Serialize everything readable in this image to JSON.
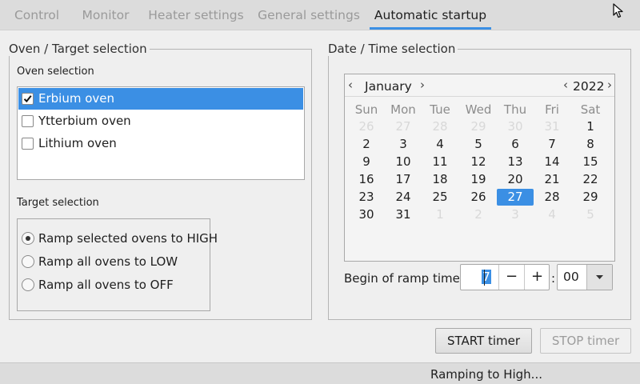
{
  "tabs": [
    {
      "label": "Control",
      "active": false
    },
    {
      "label": "Monitor",
      "active": false
    },
    {
      "label": "Heater settings",
      "active": false
    },
    {
      "label": "General settings",
      "active": false
    },
    {
      "label": "Automatic startup",
      "active": true
    }
  ],
  "oven_group": {
    "title": "Oven / Target selection",
    "oven_selection_label": "Oven selection",
    "ovens": [
      {
        "label": "Erbium oven",
        "checked": true,
        "selected": true
      },
      {
        "label": "Ytterbium oven",
        "checked": false,
        "selected": false
      },
      {
        "label": "Lithium oven",
        "checked": false,
        "selected": false
      }
    ],
    "target_selection_label": "Target selection",
    "targets": [
      {
        "label": "Ramp selected ovens to HIGH",
        "checked": true
      },
      {
        "label": "Ramp all ovens to LOW",
        "checked": false
      },
      {
        "label": "Ramp all ovens to OFF",
        "checked": false
      }
    ]
  },
  "datetime_group": {
    "title": "Date / Time selection",
    "calendar": {
      "month": "January",
      "year": "2022",
      "prev_month_icon": "chevron-left-icon",
      "next_month_icon": "chevron-right-icon",
      "weekdays": [
        "Sun",
        "Mon",
        "Tue",
        "Wed",
        "Thu",
        "Fri",
        "Sat"
      ],
      "days": [
        {
          "d": "26",
          "dim": true
        },
        {
          "d": "27",
          "dim": true
        },
        {
          "d": "28",
          "dim": true
        },
        {
          "d": "29",
          "dim": true
        },
        {
          "d": "30",
          "dim": true
        },
        {
          "d": "31",
          "dim": true
        },
        {
          "d": "1"
        },
        {
          "d": "2"
        },
        {
          "d": "3"
        },
        {
          "d": "4"
        },
        {
          "d": "5"
        },
        {
          "d": "6"
        },
        {
          "d": "7"
        },
        {
          "d": "8"
        },
        {
          "d": "9"
        },
        {
          "d": "10"
        },
        {
          "d": "11"
        },
        {
          "d": "12"
        },
        {
          "d": "13"
        },
        {
          "d": "14"
        },
        {
          "d": "15"
        },
        {
          "d": "16"
        },
        {
          "d": "17"
        },
        {
          "d": "18"
        },
        {
          "d": "19"
        },
        {
          "d": "20"
        },
        {
          "d": "21"
        },
        {
          "d": "22"
        },
        {
          "d": "23"
        },
        {
          "d": "24"
        },
        {
          "d": "25"
        },
        {
          "d": "26"
        },
        {
          "d": "27",
          "selected": true
        },
        {
          "d": "28"
        },
        {
          "d": "29"
        },
        {
          "d": "30"
        },
        {
          "d": "31"
        },
        {
          "d": "1",
          "dim": true
        },
        {
          "d": "2",
          "dim": true
        },
        {
          "d": "3",
          "dim": true
        },
        {
          "d": "4",
          "dim": true
        },
        {
          "d": "5",
          "dim": true
        }
      ]
    },
    "ramp_time_label": "Begin of ramp time",
    "hour_value": "7",
    "decrement_label": "−",
    "increment_label": "+",
    "separator": ":",
    "minute_value": "00"
  },
  "buttons": {
    "start": "START timer",
    "stop": "STOP timer"
  },
  "status": "Ramping to High...",
  "colors": {
    "accent": "#3b8fe4",
    "tabbar": "#dcdcdc",
    "background": "#efefef"
  }
}
